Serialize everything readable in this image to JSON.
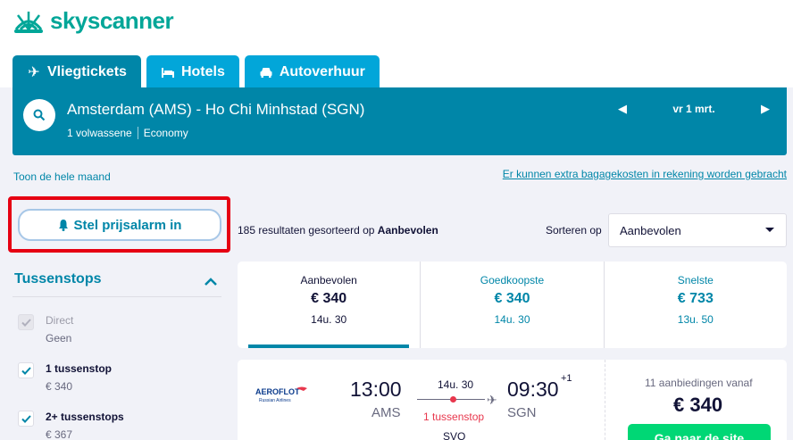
{
  "brand": {
    "name": "skyscanner"
  },
  "tabs": [
    {
      "label": "Vliegtickets",
      "icon": "plane-icon"
    },
    {
      "label": "Hotels",
      "icon": "bed-icon"
    },
    {
      "label": "Autoverhuur",
      "icon": "car-icon"
    }
  ],
  "search": {
    "route": "Amsterdam (AMS) - Ho Chi Minhstad (SGN)",
    "passengers": "1 volwassene",
    "cabin": "Economy",
    "date": "vr 1 mrt."
  },
  "links": {
    "month": "Toon de hele maand",
    "baggage": "Er kunnen extra bagagekosten in rekening worden gebracht"
  },
  "alarm": {
    "label": "Stel prijsalarm in"
  },
  "results": {
    "count_text": "185 resultaten gesorteerd op",
    "sorted_by": "Aanbevolen"
  },
  "sort": {
    "label": "Sorteren op",
    "selected": "Aanbevolen"
  },
  "filters": {
    "title": "Tussenstops",
    "items": [
      {
        "name": "Direct",
        "sub": "Geen",
        "checked": true,
        "disabled": true
      },
      {
        "name": "1 tussenstop",
        "sub": "€ 340",
        "checked": true,
        "disabled": false
      },
      {
        "name": "2+ tussenstops",
        "sub": "€ 367",
        "checked": true,
        "disabled": false
      }
    ]
  },
  "sort_tabs": [
    {
      "label": "Aanbevolen",
      "price": "€ 340",
      "duration": "14u. 30"
    },
    {
      "label": "Goedkoopste",
      "price": "€ 340",
      "duration": "14u. 30"
    },
    {
      "label": "Snelste",
      "price": "€ 733",
      "duration": "13u. 50"
    }
  ],
  "flight": {
    "airline": "AEROFLOT",
    "airline_sub": "Russian Airlines",
    "dep_time": "13:00",
    "dep_code": "AMS",
    "duration": "14u. 30",
    "stops": "1 tussenstop",
    "via": "SVO",
    "arr_time": "09:30",
    "arr_plus": "+1",
    "arr_code": "SGN",
    "offers": "11 aanbiedingen vanaf",
    "price": "€ 340",
    "cta": "Ga naar de site"
  },
  "colors": {
    "primary": "#0086a8",
    "tab": "#02a6d9",
    "cta": "#00d775",
    "highlight": "#e60012"
  }
}
